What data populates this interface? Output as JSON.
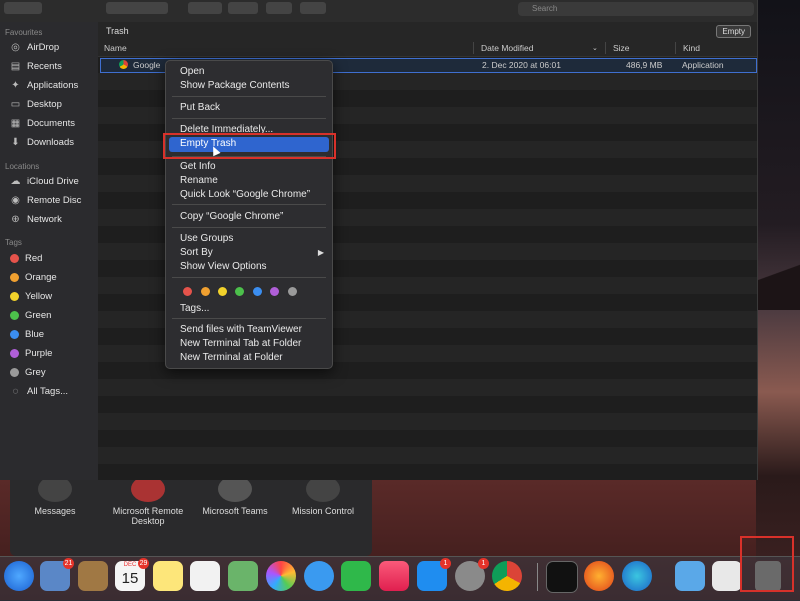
{
  "finder": {
    "search_placeholder": "Search",
    "location_title": "Trash",
    "empty_button": "Empty",
    "columns": {
      "name": "Name",
      "date": "Date Modified",
      "size": "Size",
      "kind": "Kind"
    },
    "row": {
      "name": "Google",
      "date": "2. Dec 2020 at 06:01",
      "size": "486,9 MB",
      "kind": "Application"
    }
  },
  "sidebar": {
    "favourites_label": "Favourites",
    "favourites": [
      {
        "label": "AirDrop",
        "icon": "airdrop-icon"
      },
      {
        "label": "Recents",
        "icon": "recents-icon"
      },
      {
        "label": "Applications",
        "icon": "applications-icon"
      },
      {
        "label": "Desktop",
        "icon": "desktop-icon"
      },
      {
        "label": "Documents",
        "icon": "documents-icon"
      },
      {
        "label": "Downloads",
        "icon": "downloads-icon"
      }
    ],
    "locations_label": "Locations",
    "locations": [
      {
        "label": "iCloud Drive",
        "icon": "cloud-icon"
      },
      {
        "label": "Remote Disc",
        "icon": "disc-icon"
      },
      {
        "label": "Network",
        "icon": "network-icon"
      }
    ],
    "tags_label": "Tags",
    "tags": [
      {
        "label": "Red",
        "color": "#e5534b"
      },
      {
        "label": "Orange",
        "color": "#f0a030"
      },
      {
        "label": "Yellow",
        "color": "#f2d22b"
      },
      {
        "label": "Green",
        "color": "#4cc04b"
      },
      {
        "label": "Blue",
        "color": "#3b8ef0"
      },
      {
        "label": "Purple",
        "color": "#b05fd8"
      },
      {
        "label": "Grey",
        "color": "#9a9a9a"
      },
      {
        "label": "All Tags...",
        "color": ""
      }
    ]
  },
  "menu": {
    "items": {
      "open": "Open",
      "show_package": "Show Package Contents",
      "put_back": "Put Back",
      "delete_immediately": "Delete Immediately...",
      "empty_trash": "Empty Trash",
      "get_info": "Get Info",
      "rename": "Rename",
      "quick_look": "Quick Look “Google Chrome”",
      "copy": "Copy “Google Chrome”",
      "use_groups": "Use Groups",
      "sort_by": "Sort By",
      "show_view_options": "Show View Options",
      "tags": "Tags...",
      "teamviewer": "Send files with TeamViewer",
      "new_terminal_tab": "New Terminal Tab at Folder",
      "new_terminal": "New Terminal at Folder"
    },
    "tag_colors": [
      "#e5534b",
      "#f0a030",
      "#f2d22b",
      "#4cc04b",
      "#3b8ef0",
      "#b05fd8",
      "#9a9a9a"
    ]
  },
  "launchpad": {
    "items": [
      "Messages",
      "Microsoft Remote Desktop",
      "Microsoft Teams",
      "Mission Control"
    ]
  },
  "dock": {
    "calendar_day": "15",
    "calendar_month": "DEC",
    "badges": {
      "contacts": "21",
      "calendar": "29",
      "app_store": "1",
      "settings": "1"
    }
  }
}
